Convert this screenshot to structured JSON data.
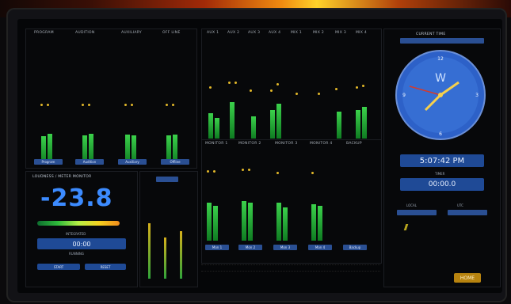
{
  "top_left_title": "",
  "program_section": {
    "headers": [
      "PROGRAM",
      "AUDITION",
      "AUXILIARY",
      "OFF LINE"
    ],
    "labels": [
      "Program",
      "Audition",
      "Auxiliary",
      "Offline"
    ]
  },
  "aux_section": {
    "headers": [
      "AUX 1",
      "AUX 2",
      "AUX 3",
      "AUX 4",
      "MIX 1",
      "MIX 2",
      "MIX 3",
      "MIX 4"
    ]
  },
  "monitor_section": {
    "headers": [
      "MONITOR 1",
      "MONITOR 2",
      "MONITOR 3",
      "MONITOR 4",
      "BACKUP"
    ],
    "labels": [
      "Mon 1",
      "Mon 2",
      "Mon 3",
      "Mon 4",
      "Backup"
    ]
  },
  "loudness": {
    "title": "LOUDNESS / METER MONITOR",
    "value": "-23.8",
    "timer_label": "INTEGRATED",
    "timer_value": "00:00",
    "sub_label": "RUNNING",
    "left_label": "START",
    "right_label": "RESET"
  },
  "clock": {
    "title": "CURRENT TIME",
    "label_top": "",
    "time": "5:07:42 PM",
    "timer_caption": "TIMER",
    "timer": "00:00.0",
    "lower_left": "LOCAL",
    "lower_right": "UTC",
    "status_text": "",
    "status_count": "",
    "home_button": "HOME"
  },
  "ui": {
    "accent": "#2a4f93",
    "meter": "#3bd14b",
    "peak": "#e3b829",
    "button": "#b7830f"
  }
}
